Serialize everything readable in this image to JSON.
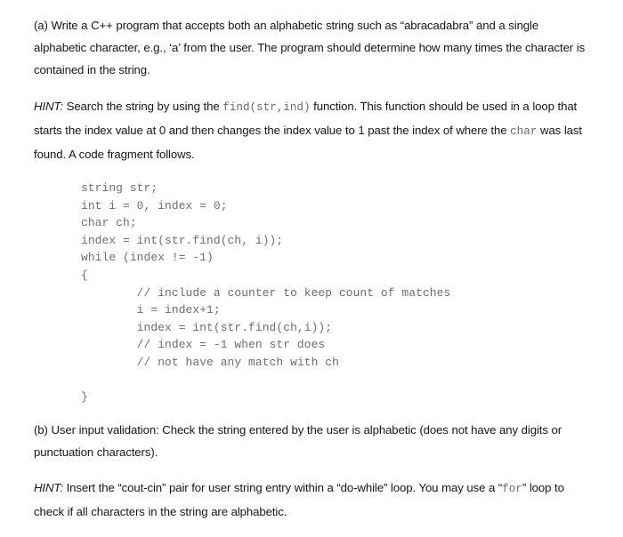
{
  "document": {
    "type": "homework-question",
    "background_color": "#ffffff",
    "text_color": "#161616",
    "code_color": "#6d6d6d"
  },
  "part_a": {
    "label": "(a)",
    "text": "(a) Write a C++ program that accepts both an alphabetic string such as “abracadabra” and a single alphabetic character, e.g., ‘a’ from the user. The program should determine how many times the character is contained in the string."
  },
  "hint_a": {
    "label": "HINT:",
    "segment_1": " Search the string by using the ",
    "code_1": "find(str,ind)",
    "segment_2": " function. This function should be used in a loop that starts the index value at 0 and then changes the index value to 1 past the index of where the ",
    "code_2": "char",
    "segment_3": " was last found. A code fragment follows."
  },
  "code_fragment": {
    "language": "cpp",
    "lines": [
      "string str;",
      "int i = 0, index = 0;",
      "char ch;",
      "index = int(str.find(ch, i));",
      "while (index != -1)",
      "{",
      "        // include a counter to keep count of matches",
      "        i = index+1;",
      "        index = int(str.find(ch,i));",
      "        // index = -1 when str does",
      "        // not have any match with ch",
      "",
      "}"
    ],
    "text": "string str;\nint i = 0, index = 0;\nchar ch;\nindex = int(str.find(ch, i));\nwhile (index != -1)\n{\n        // include a counter to keep count of matches\n        i = index+1;\n        index = int(str.find(ch,i));\n        // index = -1 when str does\n        // not have any match with ch\n\n}"
  },
  "part_b": {
    "label": "(b)",
    "text": "(b) User input validation: Check the string entered by the user is alphabetic (does not have any digits or punctuation characters)."
  },
  "hint_b": {
    "label": "HINT:",
    "segment_1": " Insert the “cout-cin” pair for user string entry within a “do-while” loop. You may use a “",
    "code_1": "for",
    "segment_2": "” loop to check if all characters in the string are alphabetic."
  }
}
